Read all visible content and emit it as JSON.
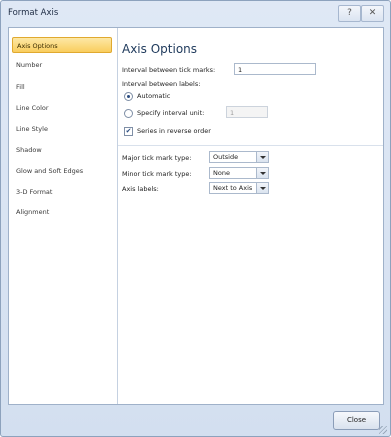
{
  "window": {
    "title": "Format Axis",
    "help_glyph": "?",
    "close_glyph": "✕"
  },
  "nav": {
    "items": [
      {
        "label": "Axis Options",
        "selected": true
      },
      {
        "label": "Number",
        "selected": false
      },
      {
        "label": "Fill",
        "selected": false
      },
      {
        "label": "Line Color",
        "selected": false
      },
      {
        "label": "Line Style",
        "selected": false
      },
      {
        "label": "Shadow",
        "selected": false
      },
      {
        "label": "Glow and Soft Edges",
        "selected": false
      },
      {
        "label": "3-D Format",
        "selected": false
      },
      {
        "label": "Alignment",
        "selected": false
      }
    ]
  },
  "panel": {
    "heading": "Axis Options",
    "tick_marks_interval_label": "Interval between tick marks:",
    "tick_marks_interval_value": "1",
    "labels_interval_label": "Interval between labels:",
    "automatic_label": "Automatic",
    "automatic_checked": true,
    "specify_label": "Specify interval unit:",
    "specify_checked": false,
    "specify_value": "1",
    "reverse_label": "Series in reverse order",
    "reverse_checked": true,
    "major_tick_label": "Major tick mark type:",
    "major_tick_value": "Outside",
    "minor_tick_label": "Minor tick mark type:",
    "minor_tick_value": "None",
    "axis_labels_label": "Axis labels:",
    "axis_labels_value": "Next to Axis",
    "check_glyph": "✔"
  },
  "footer": {
    "close_label": "Close"
  }
}
